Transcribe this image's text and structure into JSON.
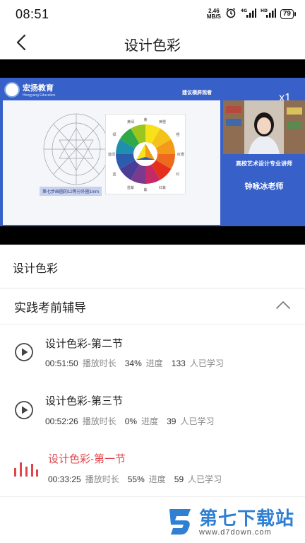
{
  "status_bar": {
    "time": "08:51",
    "net_speed_value": "2.46",
    "net_speed_unit": "MB/S",
    "battery": "79",
    "icons": [
      "alarm-icon",
      "signal-icon",
      "signal-icon"
    ]
  },
  "nav": {
    "title": "设计色彩",
    "back_icon": "chevron-left-icon"
  },
  "video": {
    "brand_name": "宏扬教育",
    "brand_sub": "Hongyang Education",
    "hint": "建议横屏观看",
    "speed_label": "x1",
    "caption_tag": "第七步画圆的12等分外圈1mm",
    "teacher_title": "高校艺术设计专业讲师",
    "teacher_name": "钟咏冰老师",
    "wheel_labels": [
      "黄",
      "黄绿",
      "绿",
      "蓝绿",
      "蓝",
      "蓝紫",
      "紫",
      "红紫",
      "红",
      "红橙",
      "橙",
      "黄橙"
    ]
  },
  "course": {
    "title": "设计色彩"
  },
  "chapter": {
    "title": "实践考前辅导",
    "expanded": true
  },
  "lessons": [
    {
      "title": "设计色彩-第二节",
      "duration": "00:51:50",
      "duration_label": "播放时长",
      "progress": "34%",
      "progress_label": "进度",
      "learners": "133",
      "learners_label": "人已学习",
      "playing": false
    },
    {
      "title": "设计色彩-第三节",
      "duration": "00:52:26",
      "duration_label": "播放时长",
      "progress": "0%",
      "progress_label": "进度",
      "learners": "39",
      "learners_label": "人已学习",
      "playing": false
    },
    {
      "title": "设计色彩-第一节",
      "duration": "00:33:25",
      "duration_label": "播放时长",
      "progress": "55%",
      "progress_label": "进度",
      "learners": "59",
      "learners_label": "人已学习",
      "playing": true
    }
  ],
  "watermark": {
    "main": "第七下载站",
    "sub": "www.d7down.com"
  },
  "colors": {
    "accent": "#e0454b",
    "slide_bg": "#3760c9",
    "watermark": "#2f7fd3"
  }
}
